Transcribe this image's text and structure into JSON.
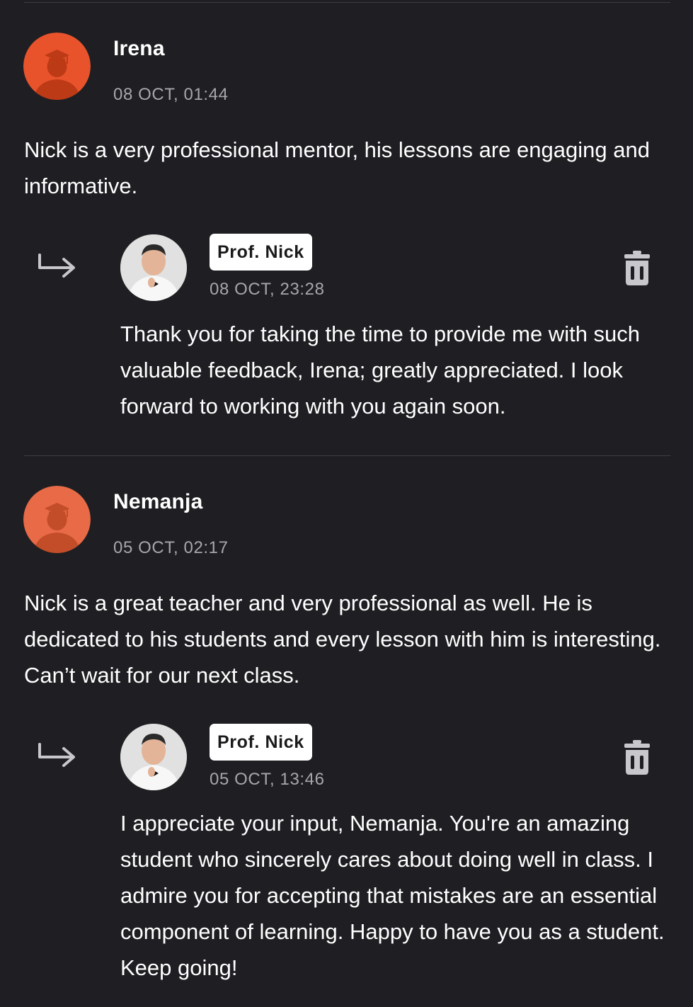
{
  "reviews": [
    {
      "student_name": "Irena",
      "date": "08 OCT, 01:44",
      "text": "Nick is a very professional mentor, his lessons are engaging and informative.",
      "avatar_icon": "graduation-cap-icon",
      "reply": {
        "author": "Prof. Nick",
        "date": "08 OCT, 23:28",
        "text": "Thank you for taking the time to provide me with such valuable feedback, Irena; greatly appreciated. I look forward to working with you again soon."
      }
    },
    {
      "student_name": "Nemanja",
      "date": "05 OCT, 02:17",
      "text": "Nick is a great teacher and very professional as well. He is dedicated to his students and every lesson with him is interesting. Can’t wait for our next class.",
      "avatar_icon": "graduation-cap-icon",
      "reply": {
        "author": "Prof. Nick",
        "date": "05 OCT, 13:46",
        "text": "I appreciate your input, Nemanja. You're an amazing student who sincerely cares about doing well in class. I admire you for accepting that mistakes are an essential component of learning. Happy to have you as a student. Keep going!"
      }
    }
  ],
  "colors": {
    "background": "#1f1f23",
    "student_avatar_1": "#e8532c",
    "student_avatar_2": "#e86a46",
    "muted_text": "#a7a7ab",
    "icon": "#c8c8cc"
  }
}
